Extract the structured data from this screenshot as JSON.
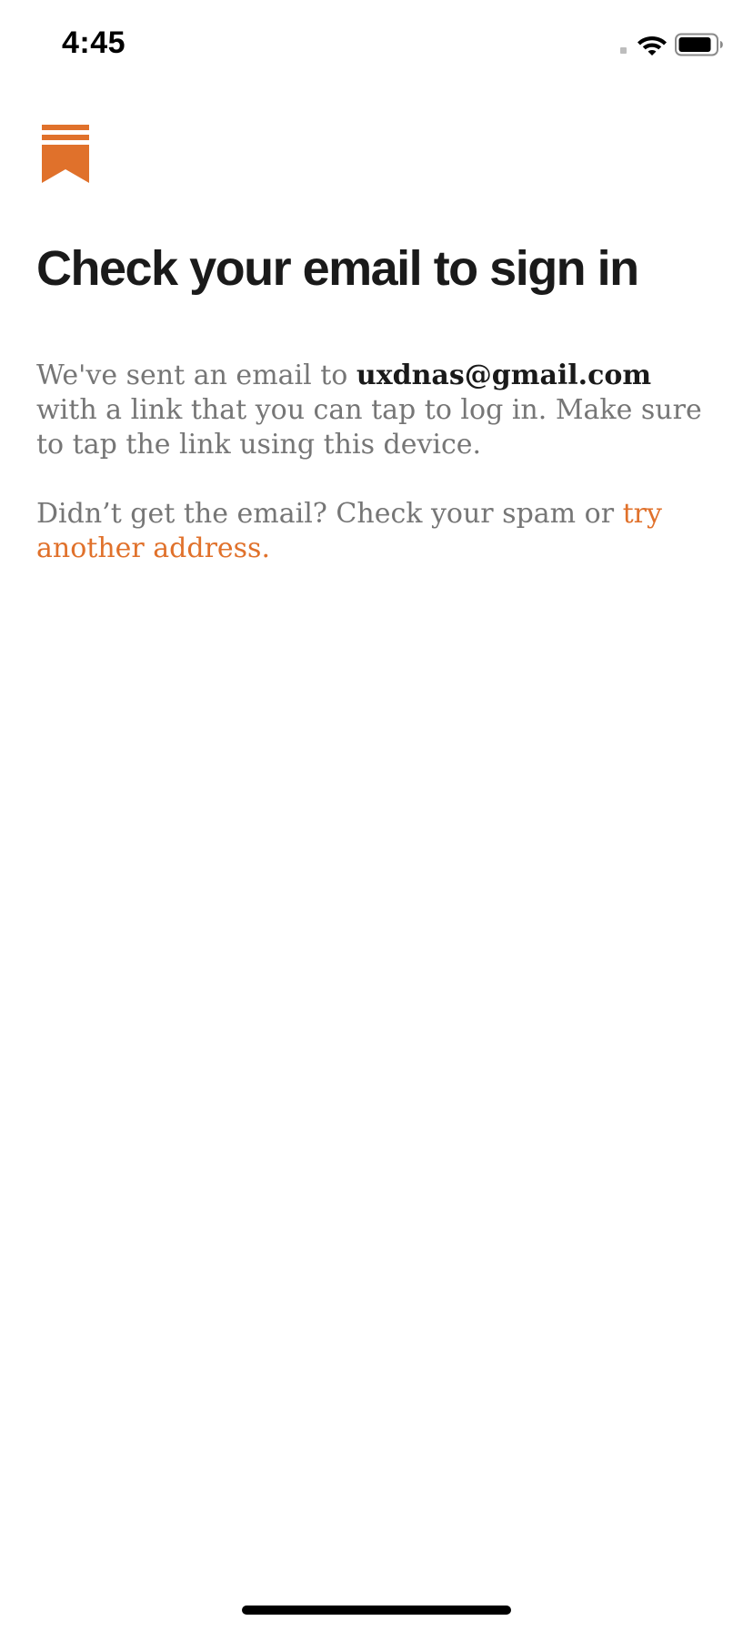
{
  "status_bar": {
    "time": "4:45",
    "icons": [
      "signal-icon",
      "wifi-icon",
      "battery-icon"
    ]
  },
  "brand": {
    "logo_icon": "bookmark-logo-icon",
    "accent_color": "#e0712b"
  },
  "content": {
    "title": "Check your email to sign in",
    "paragraph1": {
      "before": "We've sent an email to ",
      "email": "uxdnas@gmail.com",
      "after": " with a link that you can tap to log in. Make sure to tap the link using this device."
    },
    "paragraph2": {
      "before": "Didn’t get the email? Check your spam or ",
      "link": "try another address."
    }
  },
  "colors": {
    "title": "#1a1a1a",
    "body": "#767676",
    "accent": "#e0712b",
    "background": "#ffffff"
  }
}
